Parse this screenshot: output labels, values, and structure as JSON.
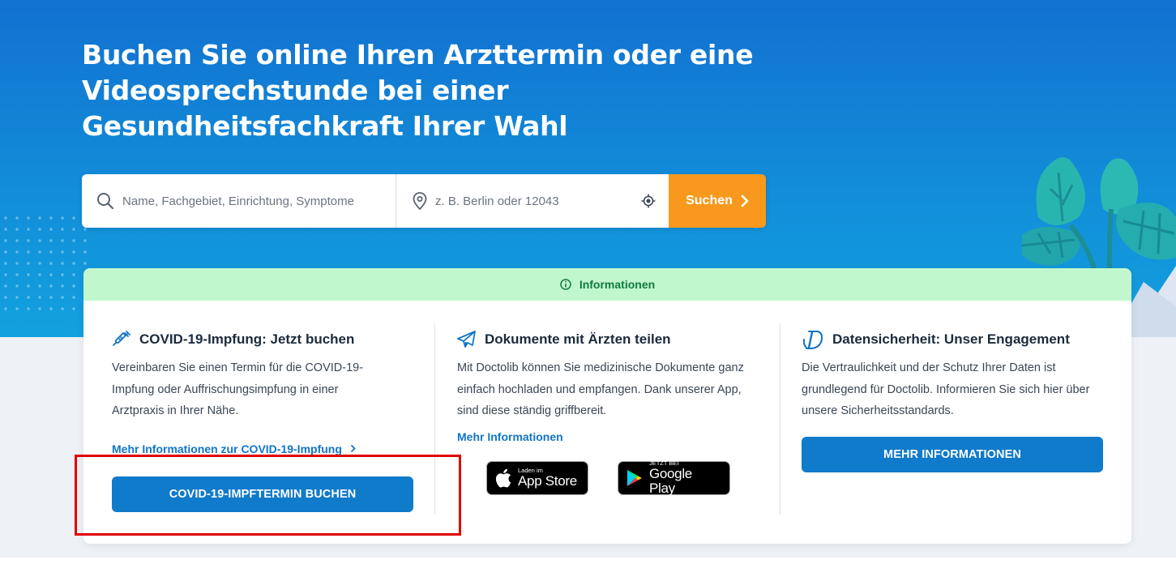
{
  "hero": {
    "title": "Buchen Sie online Ihren Arzttermin oder eine Videosprechstunde bei einer Gesundheitsfachkraft Ihrer Wahl"
  },
  "search": {
    "query_placeholder": "Name, Fachgebiet, Einrichtung, Symptome",
    "location_placeholder": "z. B. Berlin oder 12043",
    "button_label": "Suchen"
  },
  "info": {
    "header_label": "Informationen",
    "columns": [
      {
        "title": "COVID-19-Impfung: Jetzt buchen",
        "text": "Vereinbaren Sie einen Termin für die COVID-19-Impfung oder Auffrischungsimpfung in einer Arztpraxis in Ihrer Nähe.",
        "link": "Mehr Informationen zur COVID-19-Impfung",
        "button": "COVID-19-IMPFTERMIN BUCHEN"
      },
      {
        "title": "Dokumente mit Ärzten teilen",
        "text": "Mit Doctolib können Sie medizinische Dokumente ganz einfach hochladen und empfangen. Dank unserer App, sind diese ständig griffbereit.",
        "link": "Mehr Informationen"
      },
      {
        "title": "Datensicherheit: Unser Engagement",
        "text": "Die Vertraulichkeit und der Schutz Ihrer Daten ist grundlegend für Doctolib. Informieren Sie sich hier über unsere Sicherheitsstandards.",
        "button": "MEHR INFORMATIONEN"
      }
    ],
    "badges": {
      "apple_small": "Laden im",
      "apple_big": "App Store",
      "google_small": "JETZT BEI",
      "google_big": "Google Play"
    }
  },
  "colors": {
    "hero_top": "#1271d1",
    "hero_bottom": "#13a1df",
    "search_button": "#f8991d",
    "primary_button": "#107acb",
    "info_header_bg": "#c1f7cd",
    "info_header_text": "#107a3c",
    "highlight": "#e00000"
  },
  "icons": [
    "search-icon",
    "location-pin-icon",
    "locate-me-icon",
    "chevron-right-icon",
    "info-circle-icon",
    "syringe-icon",
    "paper-plane-icon",
    "doctolib-logo-icon",
    "apple-icon",
    "google-play-icon"
  ]
}
